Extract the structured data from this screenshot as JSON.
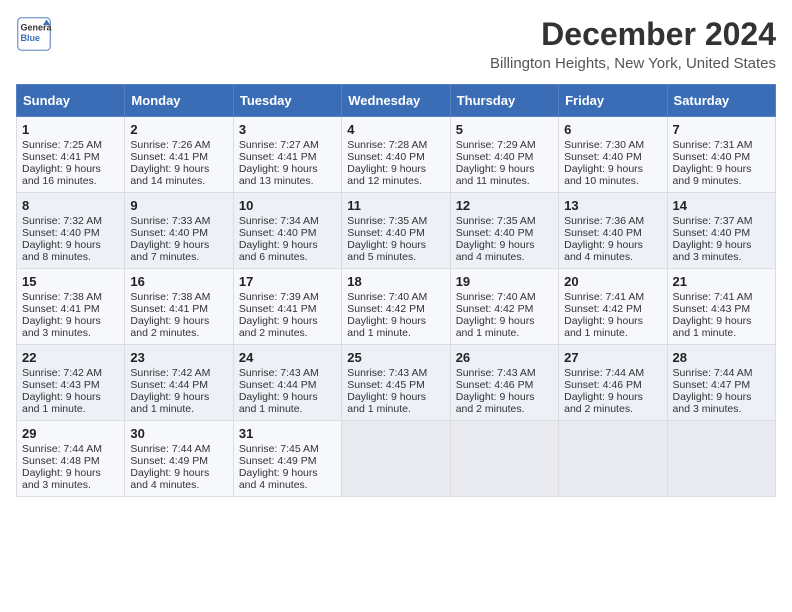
{
  "logo": {
    "line1": "General",
    "line2": "Blue"
  },
  "title": "December 2024",
  "location": "Billington Heights, New York, United States",
  "weekdays": [
    "Sunday",
    "Monday",
    "Tuesday",
    "Wednesday",
    "Thursday",
    "Friday",
    "Saturday"
  ],
  "weeks": [
    [
      {
        "day": "1",
        "sunrise": "7:25 AM",
        "sunset": "4:41 PM",
        "daylight": "9 hours and 16 minutes."
      },
      {
        "day": "2",
        "sunrise": "7:26 AM",
        "sunset": "4:41 PM",
        "daylight": "9 hours and 14 minutes."
      },
      {
        "day": "3",
        "sunrise": "7:27 AM",
        "sunset": "4:41 PM",
        "daylight": "9 hours and 13 minutes."
      },
      {
        "day": "4",
        "sunrise": "7:28 AM",
        "sunset": "4:40 PM",
        "daylight": "9 hours and 12 minutes."
      },
      {
        "day": "5",
        "sunrise": "7:29 AM",
        "sunset": "4:40 PM",
        "daylight": "9 hours and 11 minutes."
      },
      {
        "day": "6",
        "sunrise": "7:30 AM",
        "sunset": "4:40 PM",
        "daylight": "9 hours and 10 minutes."
      },
      {
        "day": "7",
        "sunrise": "7:31 AM",
        "sunset": "4:40 PM",
        "daylight": "9 hours and 9 minutes."
      }
    ],
    [
      {
        "day": "8",
        "sunrise": "7:32 AM",
        "sunset": "4:40 PM",
        "daylight": "9 hours and 8 minutes."
      },
      {
        "day": "9",
        "sunrise": "7:33 AM",
        "sunset": "4:40 PM",
        "daylight": "9 hours and 7 minutes."
      },
      {
        "day": "10",
        "sunrise": "7:34 AM",
        "sunset": "4:40 PM",
        "daylight": "9 hours and 6 minutes."
      },
      {
        "day": "11",
        "sunrise": "7:35 AM",
        "sunset": "4:40 PM",
        "daylight": "9 hours and 5 minutes."
      },
      {
        "day": "12",
        "sunrise": "7:35 AM",
        "sunset": "4:40 PM",
        "daylight": "9 hours and 4 minutes."
      },
      {
        "day": "13",
        "sunrise": "7:36 AM",
        "sunset": "4:40 PM",
        "daylight": "9 hours and 4 minutes."
      },
      {
        "day": "14",
        "sunrise": "7:37 AM",
        "sunset": "4:40 PM",
        "daylight": "9 hours and 3 minutes."
      }
    ],
    [
      {
        "day": "15",
        "sunrise": "7:38 AM",
        "sunset": "4:41 PM",
        "daylight": "9 hours and 3 minutes."
      },
      {
        "day": "16",
        "sunrise": "7:38 AM",
        "sunset": "4:41 PM",
        "daylight": "9 hours and 2 minutes."
      },
      {
        "day": "17",
        "sunrise": "7:39 AM",
        "sunset": "4:41 PM",
        "daylight": "9 hours and 2 minutes."
      },
      {
        "day": "18",
        "sunrise": "7:40 AM",
        "sunset": "4:42 PM",
        "daylight": "9 hours and 1 minute."
      },
      {
        "day": "19",
        "sunrise": "7:40 AM",
        "sunset": "4:42 PM",
        "daylight": "9 hours and 1 minute."
      },
      {
        "day": "20",
        "sunrise": "7:41 AM",
        "sunset": "4:42 PM",
        "daylight": "9 hours and 1 minute."
      },
      {
        "day": "21",
        "sunrise": "7:41 AM",
        "sunset": "4:43 PM",
        "daylight": "9 hours and 1 minute."
      }
    ],
    [
      {
        "day": "22",
        "sunrise": "7:42 AM",
        "sunset": "4:43 PM",
        "daylight": "9 hours and 1 minute."
      },
      {
        "day": "23",
        "sunrise": "7:42 AM",
        "sunset": "4:44 PM",
        "daylight": "9 hours and 1 minute."
      },
      {
        "day": "24",
        "sunrise": "7:43 AM",
        "sunset": "4:44 PM",
        "daylight": "9 hours and 1 minute."
      },
      {
        "day": "25",
        "sunrise": "7:43 AM",
        "sunset": "4:45 PM",
        "daylight": "9 hours and 1 minute."
      },
      {
        "day": "26",
        "sunrise": "7:43 AM",
        "sunset": "4:46 PM",
        "daylight": "9 hours and 2 minutes."
      },
      {
        "day": "27",
        "sunrise": "7:44 AM",
        "sunset": "4:46 PM",
        "daylight": "9 hours and 2 minutes."
      },
      {
        "day": "28",
        "sunrise": "7:44 AM",
        "sunset": "4:47 PM",
        "daylight": "9 hours and 3 minutes."
      }
    ],
    [
      {
        "day": "29",
        "sunrise": "7:44 AM",
        "sunset": "4:48 PM",
        "daylight": "9 hours and 3 minutes."
      },
      {
        "day": "30",
        "sunrise": "7:44 AM",
        "sunset": "4:49 PM",
        "daylight": "9 hours and 4 minutes."
      },
      {
        "day": "31",
        "sunrise": "7:45 AM",
        "sunset": "4:49 PM",
        "daylight": "9 hours and 4 minutes."
      },
      null,
      null,
      null,
      null
    ]
  ],
  "labels": {
    "sunrise": "Sunrise:",
    "sunset": "Sunset:",
    "daylight": "Daylight:"
  }
}
